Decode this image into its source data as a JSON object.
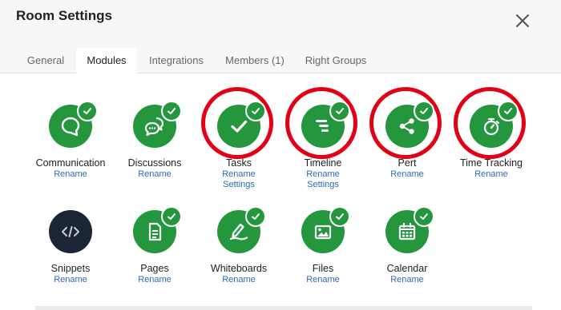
{
  "dialog": {
    "title": "Room Settings"
  },
  "icons": {
    "close": "close-icon"
  },
  "tabs": [
    {
      "label": "General",
      "active": false
    },
    {
      "label": "Modules",
      "active": true
    },
    {
      "label": "Integrations",
      "active": false
    },
    {
      "label": "Members (1)",
      "active": false
    },
    {
      "label": "Right Groups",
      "active": false
    }
  ],
  "colors": {
    "module_green": "#23963e",
    "snippets_dark": "#1c2535",
    "highlight_ring": "#e30016",
    "link_blue": "#2a6bb8"
  },
  "modules": [
    {
      "name": "Communication",
      "icon": "chat-bubble-icon",
      "enabled": true,
      "highlighted": false,
      "links": [
        "Rename"
      ]
    },
    {
      "name": "Discussions",
      "icon": "discussion-bubbles-icon",
      "enabled": true,
      "highlighted": false,
      "links": [
        "Rename"
      ]
    },
    {
      "name": "Tasks",
      "icon": "checkmark-icon",
      "enabled": true,
      "highlighted": true,
      "links": [
        "Rename",
        "Settings"
      ]
    },
    {
      "name": "Timeline",
      "icon": "timeline-bars-icon",
      "enabled": true,
      "highlighted": true,
      "links": [
        "Rename",
        "Settings"
      ]
    },
    {
      "name": "Pert",
      "icon": "share-nodes-icon",
      "enabled": true,
      "highlighted": true,
      "links": [
        "Rename"
      ]
    },
    {
      "name": "Time Tracking",
      "icon": "stopwatch-icon",
      "enabled": true,
      "highlighted": true,
      "links": [
        "Rename"
      ]
    },
    {
      "name": "Snippets",
      "icon": "code-icon",
      "enabled": false,
      "highlighted": false,
      "links": [
        "Rename"
      ]
    },
    {
      "name": "Pages",
      "icon": "document-icon",
      "enabled": true,
      "highlighted": false,
      "links": [
        "Rename"
      ]
    },
    {
      "name": "Whiteboards",
      "icon": "pen-draw-icon",
      "enabled": true,
      "highlighted": false,
      "links": [
        "Rename"
      ]
    },
    {
      "name": "Files",
      "icon": "image-file-icon",
      "enabled": true,
      "highlighted": false,
      "links": [
        "Rename"
      ]
    },
    {
      "name": "Calendar",
      "icon": "calendar-icon",
      "enabled": true,
      "highlighted": false,
      "links": [
        "Rename"
      ]
    }
  ]
}
